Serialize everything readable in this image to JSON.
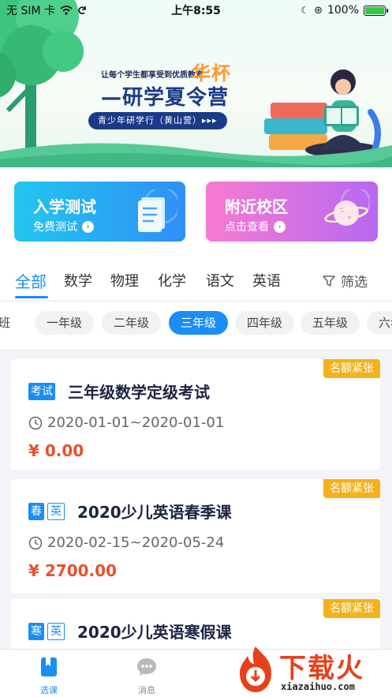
{
  "status_bar": {
    "carrier": "无 SIM 卡",
    "time": "上午8:55",
    "battery": "100%",
    "battery_level": 1.0
  },
  "banner": {
    "slogan": "让每个学生都享受到优质教育",
    "brand": "华杯",
    "headline": "—研学夏令营",
    "ribbon": "青少年研学行（黄山营）▸▸▸"
  },
  "quick_cards": [
    {
      "title": "入学测试",
      "subtitle": "免费测试",
      "icon": "document-icon",
      "color_start": "#22c6ef",
      "color_end": "#2f8ff6"
    },
    {
      "title": "附近校区",
      "subtitle": "点击查看",
      "icon": "planet-icon",
      "color_start": "#f77bd1",
      "color_end": "#b768f2"
    }
  ],
  "subjects": {
    "tabs": [
      "全部",
      "数学",
      "物理",
      "化学",
      "语文",
      "英语"
    ],
    "active_index": 0,
    "filter_label": "筛选"
  },
  "grades": {
    "chips": [
      "班",
      "一年级",
      "二年级",
      "三年级",
      "四年级",
      "五年级",
      "六年"
    ],
    "active_index": 3
  },
  "courses": [
    {
      "badge": "名额紧张",
      "tags": [
        {
          "text": "考试",
          "style": "solid"
        }
      ],
      "title": "三年级数学定级考试",
      "dates": "2020-01-01~2020-01-01",
      "price": "¥ 0.00"
    },
    {
      "badge": "名额紧张",
      "tags": [
        {
          "text": "春",
          "style": "solid"
        },
        {
          "text": "英",
          "style": "outline"
        }
      ],
      "title": "2020少儿英语春季课",
      "dates": "2020-02-15~2020-05-24",
      "price": "¥ 2700.00"
    },
    {
      "badge": "名额紧张",
      "tags": [
        {
          "text": "寒",
          "style": "solid"
        },
        {
          "text": "英",
          "style": "outline"
        }
      ],
      "title": "2020少儿英语寒假课",
      "dates": "",
      "price": ""
    }
  ],
  "bottom_nav": {
    "items": [
      {
        "label": "选课",
        "icon": "bookmark-book-icon",
        "active": true
      },
      {
        "label": "消息",
        "icon": "chat-bubble-icon",
        "active": false
      }
    ]
  },
  "watermark": {
    "text": "下载火",
    "url": "xiazaihuo.com"
  },
  "colors": {
    "accent": "#1a8ef5",
    "badge": "#f3b21d",
    "price": "#e9502d",
    "headline": "#1a3a8a"
  }
}
